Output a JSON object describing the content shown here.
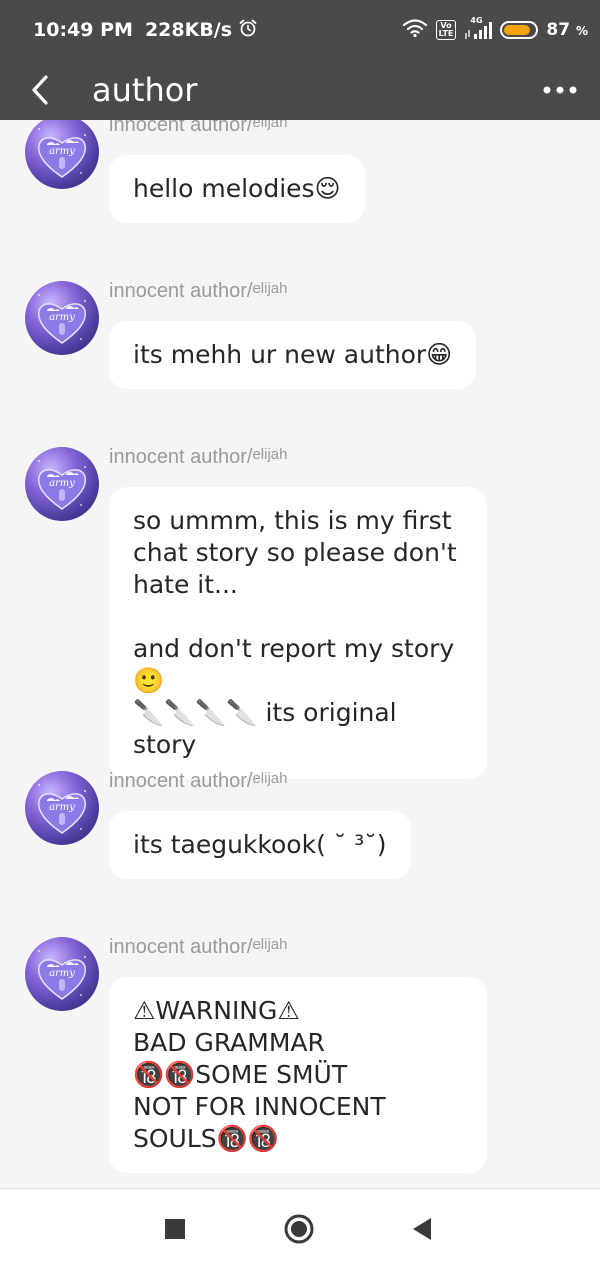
{
  "status_bar": {
    "time": "10:49 PM",
    "net_speed": "228KB/s",
    "volte": "Vo\nLTE",
    "network": "4G",
    "battery_percent": "87",
    "battery_unit": "%",
    "battery_level": 0.87,
    "battery_color": "#f2a40c"
  },
  "header": {
    "title": "author",
    "back_icon": "chevron-left-icon",
    "more_icon": "more-horizontal-icon",
    "bar_color": "#4a4a4a"
  },
  "messages": [
    {
      "sender": "innocent author/",
      "sender_suffix": "elijah",
      "text": "hello melodies😌"
    },
    {
      "sender": "innocent author/",
      "sender_suffix": "elijah",
      "text": "its mehh ur new author😁"
    },
    {
      "sender": "innocent author/",
      "sender_suffix": "elijah",
      "text": "so ummm, this is my first\nchat story so please don't\nhate it...\n\nand don't report my story🙂\n🔪🔪🔪🔪 its original story"
    },
    {
      "sender": "innocent author/",
      "sender_suffix": "elijah",
      "text": "its taegukkook( ˘ ³˘)"
    },
    {
      "sender": "innocent author/",
      "sender_suffix": "elijah",
      "text": "⚠WARNING⚠\nBAD GRAMMAR\n🔞🔞SOME SMÜT\nNOT FOR INNOCENT\nSOULS🔞🔞"
    }
  ],
  "avatar": {
    "text": "army"
  },
  "nav_bar": {
    "recents_icon": "square-icon",
    "home_icon": "circle-icon",
    "back_icon": "triangle-back-icon"
  }
}
